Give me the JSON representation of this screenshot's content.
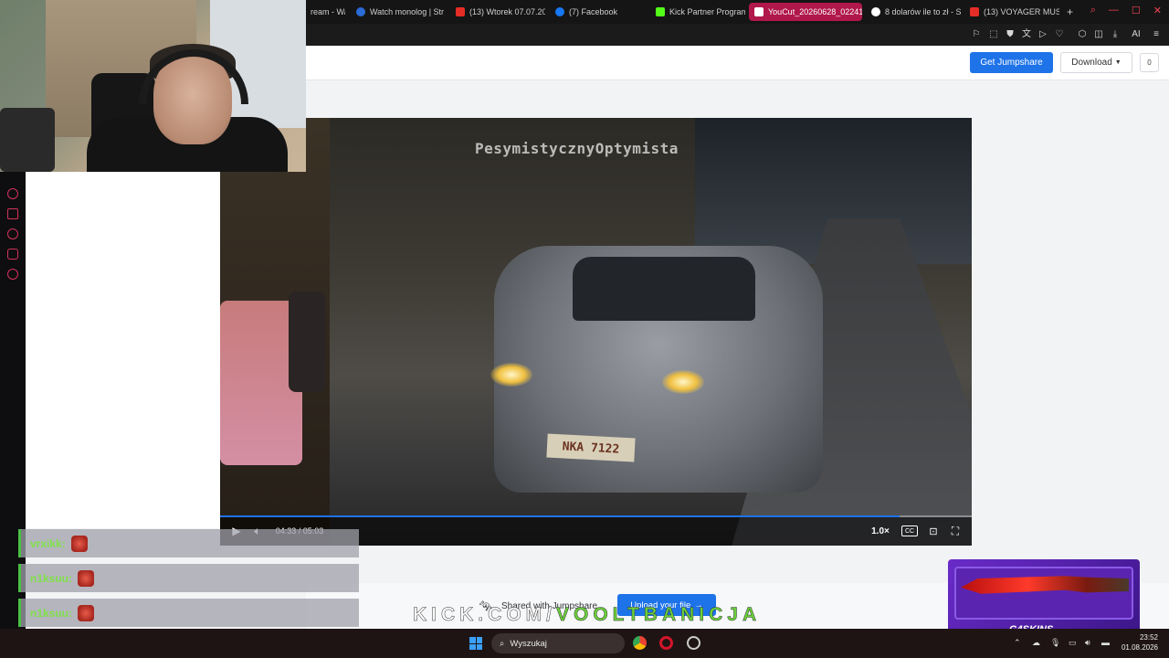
{
  "browser": {
    "tabs": [
      {
        "label": "ream - Wa",
        "color": "#2b6bd6"
      },
      {
        "label": "Watch monolog | Stre",
        "color": "#2b6bd6"
      },
      {
        "label": "(13) Wtorek 07.07.202",
        "color": "#e52d27"
      },
      {
        "label": "(7) Facebook",
        "color": "#1877f2"
      },
      {
        "label": "Kick Partner Program",
        "color": "#53fc18"
      },
      {
        "label": "YouCut_20260628_02241",
        "color": "#ffffff"
      },
      {
        "label": "8 dolarów ile to zł - S",
        "color": "#ffffff"
      },
      {
        "label": "(13) VOYAGER MUSIC",
        "color": "#e52d27"
      }
    ],
    "new_tab": "+",
    "ai_label": "AI"
  },
  "header": {
    "get_label": "Get Jumpshare",
    "download_label": "Download",
    "comment_count": "0"
  },
  "video": {
    "watermark": "PesymistycznyOptymista",
    "plate": "NKA 7122",
    "time": "04:33 / 05:03",
    "progress": 0.904,
    "speed": "1.0×",
    "cc": "CC"
  },
  "footer": {
    "shared_label": "Shared with Jumpshare",
    "upload_label": "Upload your file",
    "kick_prefix": "KICK.COM/",
    "kick_channel": "VOOLTBANICJA"
  },
  "chat": {
    "messages": [
      {
        "user": "vrxikk:"
      },
      {
        "user": "n1ksuu:"
      },
      {
        "user": "n1ksuu:"
      }
    ]
  },
  "ad": {
    "brand": "G4SKINS"
  },
  "taskbar": {
    "search_placeholder": "Wyszukaj",
    "time": "23:52",
    "date": "01.08.2026"
  },
  "colors": {
    "accent": "#1e73e8",
    "kick_green": "#6bd13a",
    "active_tab": "#b0174a"
  }
}
